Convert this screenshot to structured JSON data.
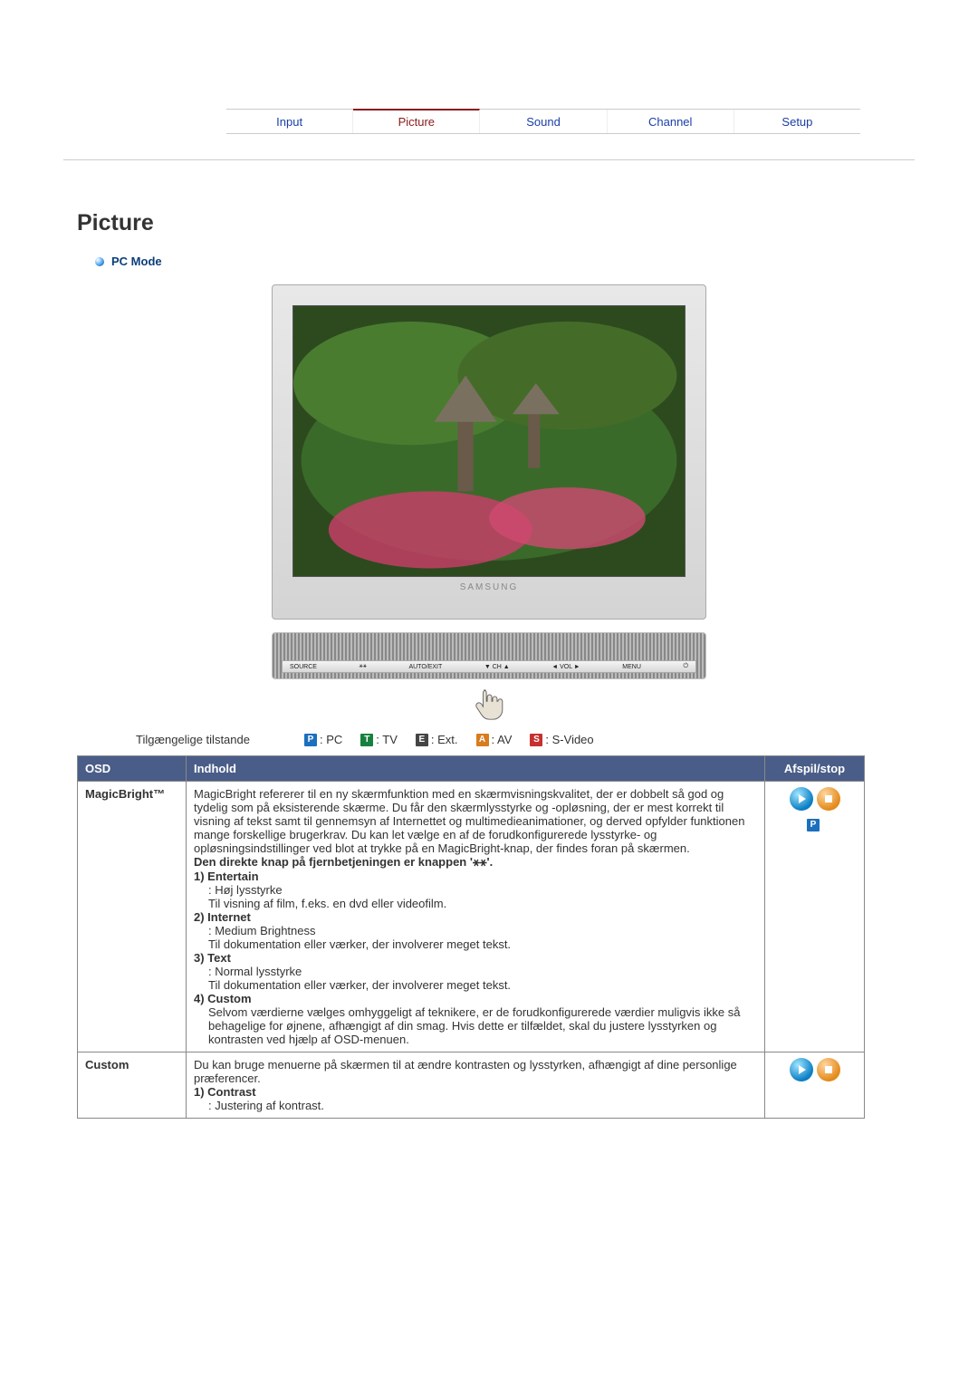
{
  "tabs": {
    "input": "Input",
    "picture": "Picture",
    "sound": "Sound",
    "channel": "Channel",
    "setup": "Setup"
  },
  "page_title": "Picture",
  "mode_heading": "PC Mode",
  "monitor_brand": "SAMSUNG",
  "front_buttons": {
    "source": "SOURCE",
    "auto": "AUTO/EXIT",
    "ch": "▼ CH ▲",
    "vol": "◄ VOL ►",
    "menu": "MENU",
    "power": "⏻"
  },
  "available_modes_label": "Tilgængelige tilstande",
  "mode_codes": {
    "P": ": PC",
    "T": ": TV",
    "E": ": Ext.",
    "A": ": AV",
    "S": ": S-Video"
  },
  "table": {
    "headers": {
      "osd": "OSD",
      "indhold": "Indhold",
      "afspil": "Afspil/stop"
    },
    "rows": {
      "magic": {
        "title": "MagicBright™",
        "intro": "MagicBright refererer til en ny skærmfunktion med en skærmvisningskvalitet, der er dobbelt så god og tydelig som på eksisterende skærme. Du får den skærmlysstyrke og -opløsning, der er mest korrekt til visning af tekst samt til gennemsyn af Internettet og multimedieanimationer, og derved opfylder funktionen mange forskellige brugerkrav. Du kan let vælge en af de forudkonfigurerede lysstyrke- og opløsningsindstillinger ved blot at trykke på en MagicBright-knap, der findes foran på skærmen.",
        "direct_btn": "Den direkte knap på fjernbetjeningen er knappen '⚹⚹'.",
        "i1_t": "1) Entertain",
        "i1_a": ": Høj lysstyrke",
        "i1_b": "Til visning af film, f.eks. en dvd eller videofilm.",
        "i2_t": "2) Internet",
        "i2_a": ": Medium Brightness",
        "i2_b": "Til dokumentation eller værker, der involverer meget tekst.",
        "i3_t": "3) Text",
        "i3_a": ": Normal lysstyrke",
        "i3_b": "Til dokumentation eller værker, der involverer meget tekst.",
        "i4_t": "4) Custom",
        "i4_a": "Selvom værdierne vælges omhyggeligt af teknikere, er de forudkonfigurerede værdier muligvis ikke så behagelige for øjnene, afhængigt af din smag. Hvis dette er tilfældet, skal du justere lysstyrken og kontrasten ved hjælp af OSD-menuen."
      },
      "custom": {
        "title": "Custom",
        "intro": "Du kan bruge menuerne på skærmen til at ændre kontrasten og lysstyrken, afhængigt af dine personlige præferencer.",
        "i1_t": "1) Contrast",
        "i1_a": ": Justering af kontrast."
      }
    }
  },
  "badge_letter_P": "P",
  "badge_letter_T": "T",
  "badge_letter_E": "E",
  "badge_letter_A": "A",
  "badge_letter_S": "S"
}
